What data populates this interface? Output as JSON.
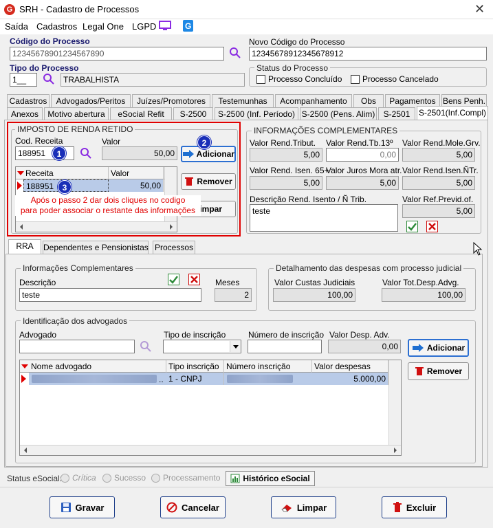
{
  "window": {
    "title": "SRH - Cadastro de Processos",
    "logo_letter": "G",
    "close": "✕"
  },
  "menu": {
    "items": [
      "Saída",
      "Cadastros",
      "Legal One",
      "LGPD"
    ]
  },
  "header": {
    "codigo_label": "Código do Processo",
    "codigo_value": "12345678901234567890",
    "novo_codigo_label": "Novo Código do Processo",
    "novo_codigo_value": "12345678912345678912",
    "tipo_label": "Tipo do Processo",
    "tipo_code": "1__",
    "tipo_value": "TRABALHISTA",
    "status_label": "Status do Processo",
    "concluido_label": "Processo Concluído",
    "cancelado_label": "Processo Cancelado"
  },
  "tabs_row1": [
    "Cadastros",
    "Advogados/Peritos",
    "Juízes/Promotores",
    "Testemunhas",
    "Acompanhamento",
    "Obs",
    "Pagamentos",
    "Bens Penh."
  ],
  "tabs_row2": [
    "Anexos",
    "Motivo abertura",
    "eSocial Refit",
    "S-2500",
    "S-2500 (Inf. Período)",
    "S-2500 (Pens. Alim)",
    "S-2501",
    "S-2501(Inf.Compl)"
  ],
  "ir": {
    "title": "IMPOSTO DE RENDA RETIDO",
    "cod_label": "Cod. Receita",
    "cod_value": "188951",
    "valor_label": "Valor",
    "valor_value": "50,00",
    "add_label": "Adicionar",
    "remove_label": "Remover",
    "clear_label": "Limpar",
    "grid_headers": [
      "Receita",
      "Valor"
    ],
    "grid_row": {
      "receita": "188951",
      "valor": "50,00"
    }
  },
  "annotation": {
    "m1": "1",
    "m2": "2",
    "m3": "3",
    "text_line1": "Após o passo 2 dar dois cliques no codigo",
    "text_line2": "para poder associar o restante das informações"
  },
  "info": {
    "title": "INFORMAÇÕES COMPLEMENTARES",
    "fields": [
      {
        "label": "Valor Rend.Tribut.",
        "value": "5,00"
      },
      {
        "label": "Valor Rend.Tb.13º",
        "value": "0,00"
      },
      {
        "label": "Valor Rend.Mole.Grv.",
        "value": "5,00"
      },
      {
        "label": "Valor Rend. Isen. 65+",
        "value": "5,00"
      },
      {
        "label": "Valor Juros Mora atr.",
        "value": "5,00"
      },
      {
        "label": "Valor Rend.Isen.ÑTr.",
        "value": "5,00"
      }
    ],
    "desc_label": "Descrição Rend. Isento / Ñ Trib.",
    "desc_value": "teste",
    "prev_label": "Valor Ref.Previd.of.",
    "prev_value": "5,00"
  },
  "subtabs": [
    "RRA",
    "Dependentes e Pensionistas",
    "Processos"
  ],
  "rra": {
    "info_title": "Informações Complementares",
    "desc_label": "Descrição",
    "desc_value": "teste",
    "meses_label": "Meses",
    "meses_value": "2",
    "desp_title": "Detalhamento das despesas com processo judicial",
    "custas_label": "Valor Custas Judiciais",
    "custas_value": "100,00",
    "tot_label": "Valor Tot.Desp.Advg.",
    "tot_value": "100,00"
  },
  "adv": {
    "title": "Identificação dos advogados",
    "adv_label": "Advogado",
    "tipo_label": "Tipo de inscrição",
    "num_label": "Número de inscrição",
    "desp_label": "Valor Desp. Adv.",
    "desp_value": "0,00",
    "add_label": "Adicionar",
    "remove_label": "Remover",
    "grid_headers": [
      "Nome advogado",
      "Tipo inscrição",
      "Número inscrição",
      "Valor despesas"
    ],
    "row": {
      "nome_suffix": "..",
      "tipo": "1 - CNPJ",
      "valor": "5.000,00"
    }
  },
  "status": {
    "label": "Status eSocial:",
    "critica": "Crítica",
    "sucesso": "Sucesso",
    "processamento": "Processamento",
    "historico": "Histórico eSocial"
  },
  "footer": {
    "gravar": "Gravar",
    "cancelar": "Cancelar",
    "limpar": "Limpar",
    "excluir": "Excluir"
  },
  "colors": {
    "accent": "#1a2fb8",
    "danger": "#e00000",
    "selection": "#b9cbe8",
    "brand": "#d52b1e"
  }
}
